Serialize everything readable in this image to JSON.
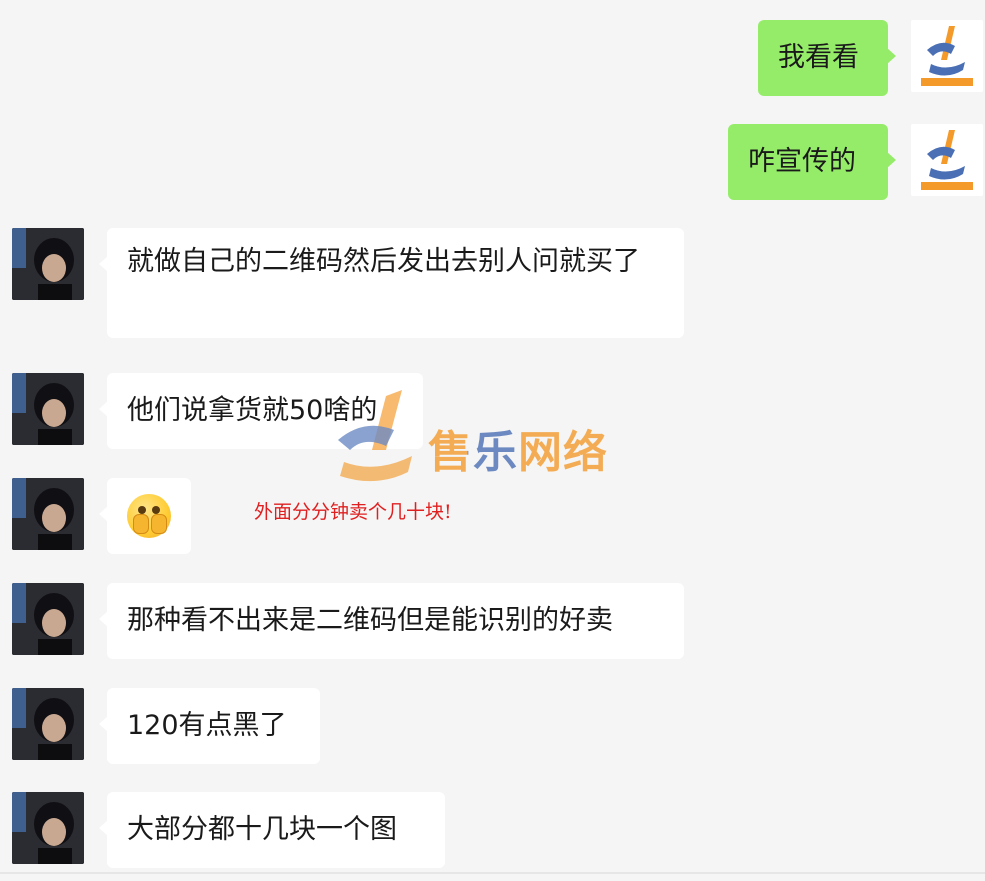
{
  "messages": [
    {
      "from": "me",
      "text": "我看看"
    },
    {
      "from": "me",
      "text": "咋宣传的"
    },
    {
      "from": "them",
      "text": "就做自己的二维码然后发出去别人问就买了"
    },
    {
      "from": "them",
      "text": "他们说拿货就50啥的"
    },
    {
      "from": "them",
      "emoji": "pensive-face-emoji"
    },
    {
      "from": "them",
      "text": "那种看不出来是二维码但是能识别的好卖"
    },
    {
      "from": "them",
      "text": "120有点黑了"
    },
    {
      "from": "them",
      "text": "大部分都十几块一个图"
    }
  ],
  "watermark": {
    "brand": "售乐网络",
    "tagline": "外面分分钟卖个几十块!"
  },
  "colors": {
    "background": "#f5f5f5",
    "my_bubble": "#95ec69",
    "their_bubble": "#ffffff",
    "watermark_blue": "#4a6fb5",
    "watermark_orange": "#f39a2b",
    "tagline_red": "#e02020"
  },
  "icons": {
    "my_avatar": "brand-logo-avatar",
    "their_avatar": "person-photo-avatar",
    "emoji": "face-with-hands-emoji"
  }
}
